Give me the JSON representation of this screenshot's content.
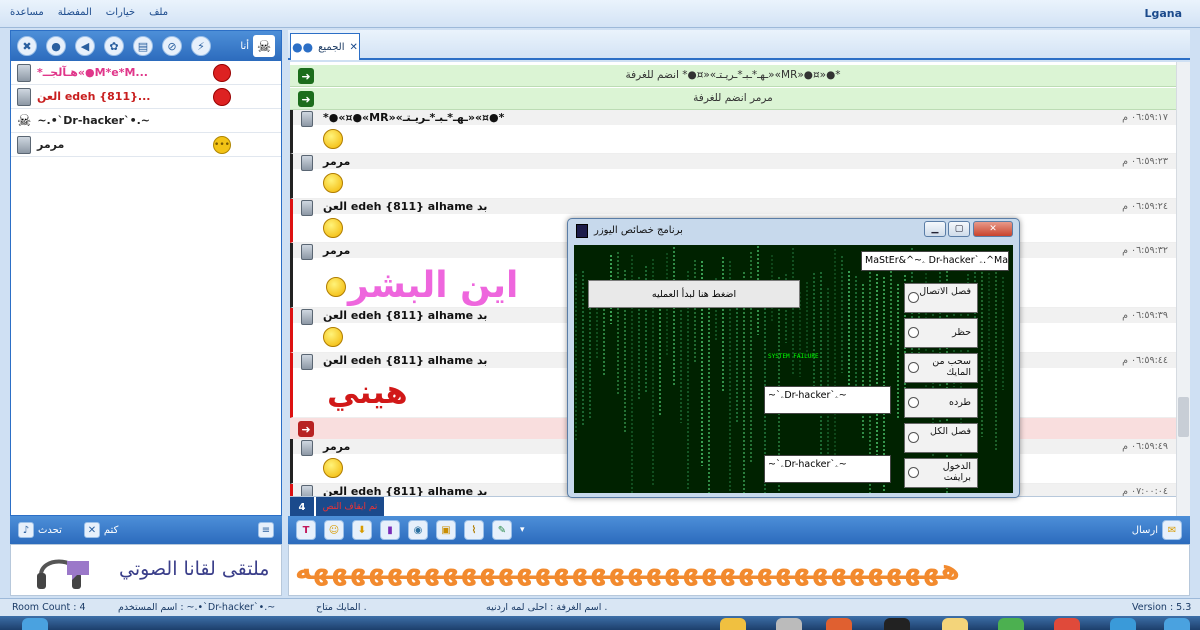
{
  "menubar": {
    "app_name": "Lgana",
    "items": [
      "ملف",
      "خيارات",
      "المفضلة",
      "مساعدة"
    ]
  },
  "left_panel": {
    "me_label": "أنا",
    "users": [
      {
        "name": "*هـآلجــ«●M*e*M...",
        "color": "#e0368a",
        "status_icon": "mute-icon"
      },
      {
        "name": "العن edeh {811}...",
        "color": "#c81e1e",
        "status_icon": "mute-icon"
      },
      {
        "name": "~.•`Dr-hacker`•.~",
        "color": "#222222",
        "status_icon": "none"
      },
      {
        "name": "مرمر",
        "color": "#222222",
        "status_icon": "talk-icon"
      }
    ],
    "bottom_bar": {
      "talk_label": "تحدث",
      "mute_label": "كتم"
    },
    "voice_banner": "ملتقى لقانا الصوتي"
  },
  "room_tab": {
    "label": "الجميع",
    "close": "✕"
  },
  "chat": {
    "system_rows": [
      {
        "text": "*●«¤●«MR»«ـهـ*ـبـ*ـريـتـ»«¤●* انضم للغرفة",
        "kind": "join"
      },
      {
        "text": "مرمر انضم للغرفة",
        "kind": "join"
      },
      {
        "text": "",
        "kind": "leave"
      }
    ],
    "messages": [
      {
        "name": "*●«¤●«MR»«ـهـ*ـبـ*ـريـتـ»«¤●*",
        "time": "٠٦:٥٩:١٧ م",
        "bar": "black"
      },
      {
        "name": "مرمر",
        "time": "٠٦:٥٩:٢٣ م",
        "bar": "black"
      },
      {
        "name": "العن edeh {811} alhame بد",
        "time": "٠٦:٥٩:٢٤ م",
        "bar": "red"
      },
      {
        "name": "مرمر",
        "time": "٠٦:٥٩:٣٢ م",
        "bar": "black",
        "text": "اين البشر",
        "text_color": "#ee66dd"
      },
      {
        "name": "العن edeh {811} alhame بد",
        "time": "٠٦:٥٩:٣٩ م",
        "bar": "red"
      },
      {
        "name": "العن edeh {811} alhame بد",
        "time": "٠٦:٥٩:٤٤ م",
        "bar": "red",
        "text": "هيني",
        "text_color": "#d11818"
      },
      {
        "name": "مرمر",
        "time": "٠٦:٥٩:٤٩ م",
        "bar": "black"
      },
      {
        "name": "العن edeh {811} alhame بد",
        "time": "٠٧:٠٠:٠٤ م",
        "bar": "red"
      }
    ],
    "queue_count": "4",
    "queue_status": "تم ايقاف النص"
  },
  "input": {
    "send_label": "ارسال",
    "text": "هههههههههههههههههههههههههههههههههههه",
    "text_color": "#f28a2e"
  },
  "status_bar": {
    "room_count": "Room Count : 4",
    "username": "اسم المستخدم : ~.•`Dr-hacker`•.~",
    "mic": "المايك متاح .",
    "room_name": "اسم الغرفة : احلى لمه اردنيه .",
    "version": "Version : 5.3"
  },
  "dialog": {
    "title": "برنامج خصائص اليوزر",
    "owner_field": "MaStEr&^~ۦ Dr-hacker`ۦ.^MaStEr",
    "start_button": "اضغط هنا لبدأ العمليه",
    "system_failure": "SYSTEM FAILURE",
    "options": [
      "فصل الاتصال",
      "حظر",
      "سحب من المايك",
      "طرده",
      "فصل الكل",
      "الدخول برايفت"
    ],
    "user_box_1": "~`ۦDr-hacker`ۦ~",
    "user_box_2": "~`ۦDr-hacker`ۦ~"
  },
  "colors": {
    "accent": "#2c6fc6",
    "join_row": "#dbf4d4",
    "leave_row": "#f9dede"
  }
}
